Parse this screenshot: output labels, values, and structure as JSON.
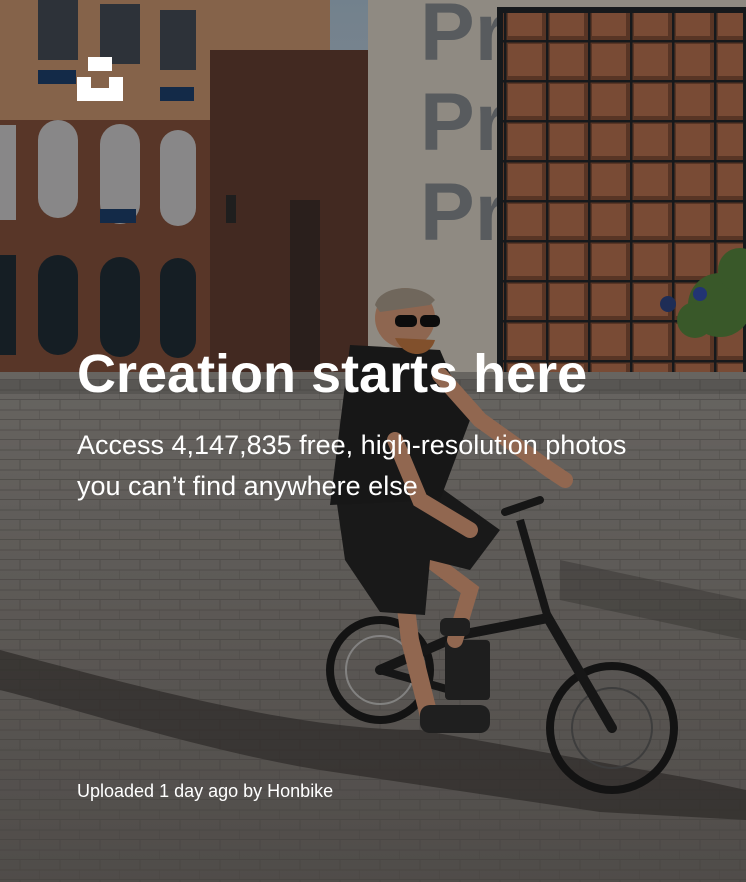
{
  "hero": {
    "headline": "Creation starts here",
    "subheadline": "Access 4,147,835 free, high-resolution photos you can’t find anywhere else",
    "credit": {
      "prefix": "Uploaded 1 day ago by ",
      "author": "Honbike"
    },
    "background_icon": "photo-cyclist-on-cobblestone-plaza"
  },
  "logo": {
    "icon": "unsplash-logo-icon",
    "color": "#ffffff"
  }
}
